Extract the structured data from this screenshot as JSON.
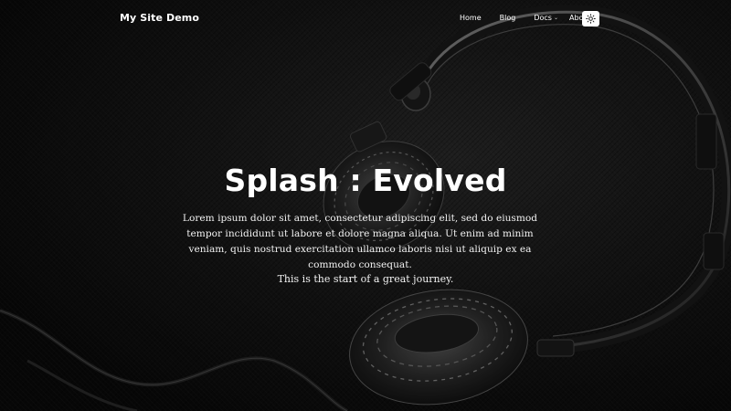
{
  "site": {
    "brand": "My Site Demo"
  },
  "nav": {
    "items": [
      {
        "label": "Home"
      },
      {
        "label": "Blog"
      },
      {
        "label": "Docs",
        "caret": "⌄"
      },
      {
        "label": "About"
      }
    ],
    "theme_toggle_icon": "sun-icon"
  },
  "hero": {
    "title": "Splash : Evolved",
    "lead": "Lorem ipsum dolor sit amet, consectetur adipiscing elit, sed do eiusmod tempor incididunt ut labore et dolore magna aliqua. Ut enim ad minim veniam, quis nostrud exercitation ullamco laboris nisi ut aliquip ex ea commodo consequat.",
    "subtitle": "This is the start of a great journey.",
    "background_icon": "headphones-image"
  },
  "colors": {
    "text": "#ffffff",
    "toggle_bg": "#ffffff",
    "background": "#111111"
  }
}
